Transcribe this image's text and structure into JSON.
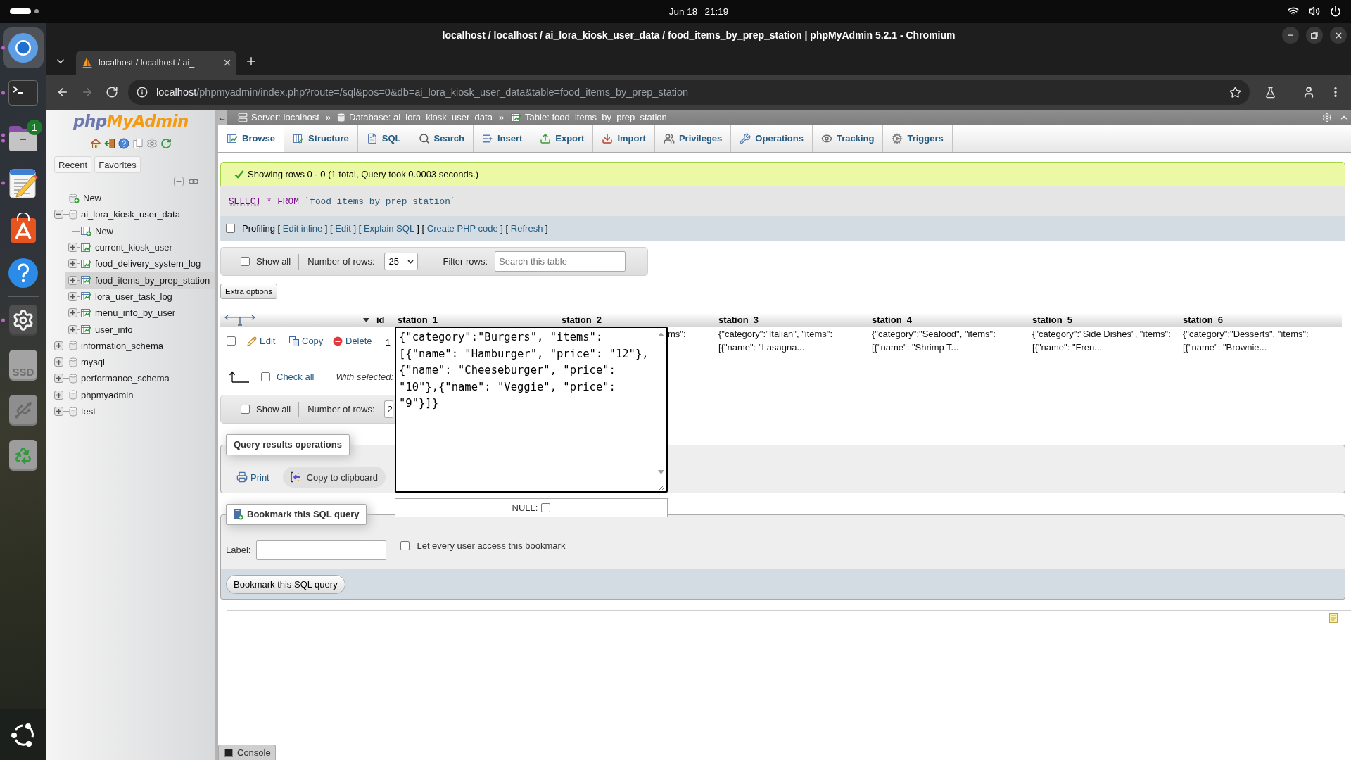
{
  "desktop": {
    "top_bar": {
      "date": "Jun 18",
      "time": "21:19"
    },
    "dock": [
      {
        "kind": "browser",
        "selected": true,
        "running": true,
        "multiple_windows": false
      },
      {
        "kind": "terminal",
        "selected": false,
        "running": true,
        "multiple_windows": false
      },
      {
        "kind": "files",
        "selected": false,
        "running": true,
        "multiple_windows": true,
        "badge": "1"
      },
      {
        "kind": "text_editor",
        "selected": false,
        "running": true,
        "multiple_windows": false
      },
      {
        "kind": "app_center",
        "selected": false,
        "running": false,
        "multiple_windows": false
      },
      {
        "kind": "help",
        "selected": false,
        "running": false,
        "multiple_windows": false
      },
      {
        "kind": "separator"
      },
      {
        "kind": "settings",
        "selected": false,
        "running": true,
        "multiple_windows": false
      },
      {
        "kind": "drive",
        "selected": false,
        "running": false,
        "multiple_windows": false,
        "label": "SSD"
      },
      {
        "kind": "usb",
        "selected": false,
        "running": false,
        "multiple_windows": false
      },
      {
        "kind": "trash",
        "selected": false,
        "running": false,
        "multiple_windows": false
      }
    ]
  },
  "browser": {
    "title": "localhost / localhost / ai_lora_kiosk_user_data / food_items_by_prep_station | phpMyAdmin 5.2.1 - Chromium",
    "tabs": [
      {
        "title": "localhost / localhost / ai_",
        "selected": true
      }
    ],
    "nav_buttons": [
      {
        "kind": "back",
        "disabled": false
      },
      {
        "kind": "forward",
        "disabled": true
      },
      {
        "kind": "reload",
        "disabled": false
      }
    ],
    "address": {
      "host": "localhost",
      "path": "/phpmyadmin/index.php?route=/sql&pos=0&db=ai_lora_kiosk_user_data&table=food_items_by_prep_station"
    }
  },
  "phpmyadmin": {
    "navigation": {
      "logo": [
        {
          "kind": "php",
          "text": "php"
        },
        {
          "kind": "my_admin",
          "text": "MyAdmin"
        }
      ],
      "panel_buttons": [
        "Recent",
        "Favorites"
      ],
      "tree": [
        {
          "kind": "new_database",
          "label": "New",
          "selected": false
        },
        {
          "kind": "database",
          "label": "ai_lora_kiosk_user_data",
          "expanded": true,
          "selected": false,
          "children": [
            {
              "kind": "new_table",
              "label": "New",
              "selected": false
            },
            {
              "kind": "table",
              "label": "current_kiosk_user",
              "expanded": false,
              "selected": false
            },
            {
              "kind": "table",
              "label": "food_delivery_system_log",
              "expanded": false,
              "selected": false
            },
            {
              "kind": "table",
              "label": "food_items_by_prep_station",
              "expanded": false,
              "selected": true
            },
            {
              "kind": "table",
              "label": "lora_user_task_log",
              "expanded": false,
              "selected": false
            },
            {
              "kind": "table",
              "label": "menu_info_by_user",
              "expanded": false,
              "selected": false
            },
            {
              "kind": "table",
              "label": "user_info",
              "expanded": false,
              "selected": false
            }
          ]
        },
        {
          "kind": "database",
          "label": "information_schema",
          "expanded": false,
          "selected": false
        },
        {
          "kind": "database",
          "label": "mysql",
          "expanded": false,
          "selected": false
        },
        {
          "kind": "database",
          "label": "performance_schema",
          "expanded": false,
          "selected": false
        },
        {
          "kind": "database",
          "label": "phpmyadmin",
          "expanded": false,
          "selected": false
        },
        {
          "kind": "database",
          "label": "test",
          "expanded": false,
          "selected": false
        }
      ]
    },
    "breadcrumb": {
      "collapser": "←",
      "items": [
        {
          "kind": "server",
          "label": "Server: localhost"
        },
        {
          "kind": "separator",
          "label": "»"
        },
        {
          "kind": "database",
          "label": "Database: ai_lora_kiosk_user_data"
        },
        {
          "kind": "separator",
          "label": "»"
        },
        {
          "kind": "table",
          "label": "Table: food_items_by_prep_station"
        }
      ]
    },
    "tabs": [
      {
        "kind": "browse",
        "label": "Browse",
        "selected": true
      },
      {
        "kind": "structure",
        "label": "Structure",
        "selected": false
      },
      {
        "kind": "sql",
        "label": "SQL",
        "selected": false
      },
      {
        "kind": "search",
        "label": "Search",
        "selected": false
      },
      {
        "kind": "insert",
        "label": "Insert",
        "selected": false
      },
      {
        "kind": "export",
        "label": "Export",
        "selected": false
      },
      {
        "kind": "import",
        "label": "Import",
        "selected": false
      },
      {
        "kind": "privileges",
        "label": "Privileges",
        "selected": false
      },
      {
        "kind": "operations",
        "label": "Operations",
        "selected": false
      },
      {
        "kind": "tracking",
        "label": "Tracking",
        "selected": false
      },
      {
        "kind": "triggers",
        "label": "Triggers",
        "selected": false
      }
    ],
    "message": {
      "kind": "success",
      "text": "Showing rows 0 - 0 (1 total, Query took 0.0003 seconds.)"
    },
    "query": [
      {
        "kind": "keyword_link",
        "text": "SELECT"
      },
      {
        "kind": "operator",
        "text": "*"
      },
      {
        "kind": "keyword",
        "text": "FROM"
      },
      {
        "kind": "identifier",
        "text": "`food_items_by_prep_station`"
      }
    ],
    "profiling": {
      "checked": false,
      "label": "Profiling",
      "links": [
        {
          "open": "[",
          "text": "Edit inline",
          "close": "]"
        },
        {
          "open": "[",
          "text": "Edit",
          "close": "]"
        },
        {
          "open": "[",
          "text": "Explain SQL",
          "close": "]"
        },
        {
          "open": "[",
          "text": "Create PHP code",
          "close": "]"
        },
        {
          "open": "[",
          "text": "Refresh",
          "close": "]"
        }
      ]
    },
    "top_controls": {
      "show_all": {
        "label": "Show all",
        "checked": false
      },
      "rows_label": "Number of rows:",
      "rows_value": "25",
      "covered": false,
      "filter": {
        "label": "Filter rows:",
        "placeholder": "Search this table"
      }
    },
    "extra_options": "Extra options",
    "results": {
      "columns": [
        "id",
        "station_1",
        "station_2",
        "station_3",
        "station_4",
        "station_5",
        "station_6"
      ],
      "rows": [
        {
          "selected": false,
          "actions": [
            {
              "kind": "edit",
              "label": "Edit"
            },
            {
              "kind": "copy",
              "label": "Copy"
            },
            {
              "kind": "delete",
              "label": "Delete"
            }
          ],
          "cells": [
            {
              "kind": "number",
              "text": "1"
            },
            {
              "kind": "editing",
              "editor": {
                "value": "{\"category\":\"Burgers\", \"items\": [{\"name\": \"Hamburger\", \"price\": \"12\"}, {\"name\": \"Cheeseburger\", \"price\": \"10\"},{\"name\": \"Veggie\", \"price\": \"9\"}]}",
                "null_label": "NULL:",
                "null_checked": false
              }
            },
            {
              "kind": "covered",
              "text": "ms\":"
            },
            {
              "kind": "text",
              "text": "{\"category\":\"Italian\", \"items\": [{\"name\": \"Lasagna..."
            },
            {
              "kind": "text",
              "text": "{\"category\":\"Seafood\", \"items\": [{\"name\": \"Shrimp T..."
            },
            {
              "kind": "text",
              "text": "{\"category\":\"Side Dishes\", \"items\": [{\"name\": \"Fren..."
            },
            {
              "kind": "text",
              "text": "{\"category\":\"Desserts\", \"items\": [{\"name\": \"Brownie..."
            }
          ]
        }
      ],
      "check_all": {
        "label": "Check all",
        "checked": false
      },
      "with_selected": "With selected:"
    },
    "bottom_controls": {
      "show_all": {
        "label": "Show all",
        "checked": false
      },
      "rows_label": "Number of rows:",
      "rows_value": "2",
      "covered": true
    },
    "query_operations": {
      "legend": "Query results operations",
      "actions": [
        {
          "kind": "print",
          "label": "Print"
        },
        {
          "kind": "copy_to_clipboard",
          "label": "Copy to clipboard"
        }
      ]
    },
    "bookmark": {
      "legend": "Bookmark this SQL query",
      "label": "Label:",
      "share": {
        "label": "Let every user access this bookmark",
        "checked": false
      },
      "submit": "Bookmark this SQL query"
    },
    "console": "Console"
  }
}
